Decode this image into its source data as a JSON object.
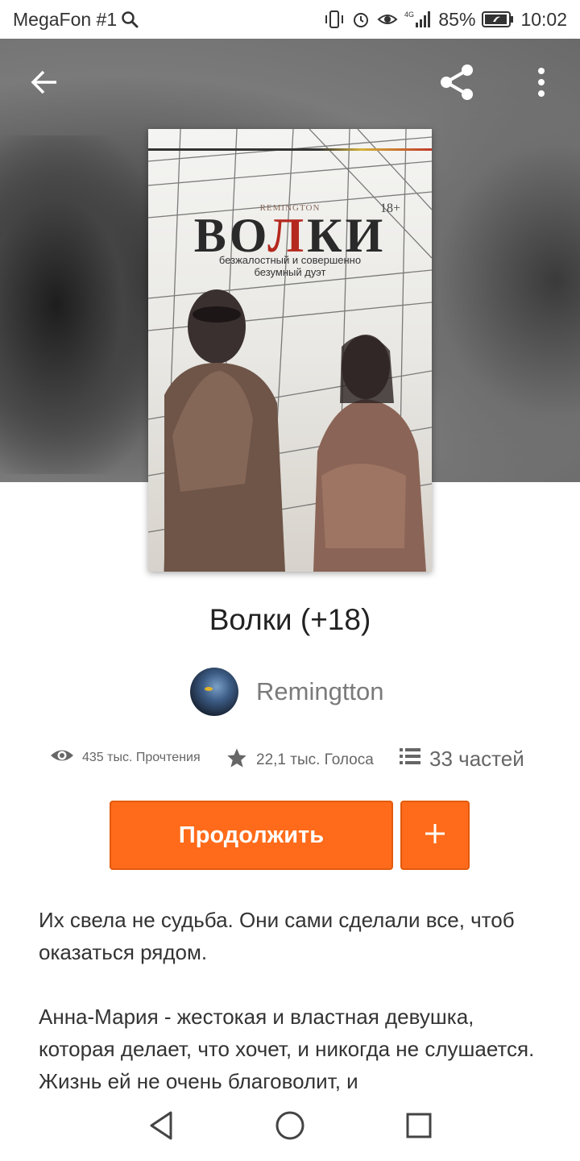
{
  "status_bar": {
    "carrier": "MegaFon #1",
    "network": "4G",
    "battery": "85%",
    "time": "10:02",
    "icons": [
      "search-icon",
      "vibrate-icon",
      "alarm-icon",
      "eye-comfort-icon",
      "signal-icon",
      "battery-icon"
    ]
  },
  "header": {
    "back_icon": "arrow-left-icon",
    "share_icon": "share-icon",
    "menu_icon": "more-vertical-icon"
  },
  "cover": {
    "brand": "REMINGTON",
    "age": "18+",
    "title_left": "ВО",
    "title_red": "Л",
    "title_right": "КИ",
    "subtitle_line1": "безжалостный и совершенно",
    "subtitle_line2": "безумный дуэт"
  },
  "book": {
    "title": "Волки (+18)",
    "author": "Remingtton"
  },
  "stats": {
    "reads": "435 тыс. Прочтения",
    "votes": "22,1 тыс. Голоса",
    "parts": "33 частей"
  },
  "actions": {
    "continue_label": "Продолжить",
    "add_icon": "plus-icon"
  },
  "description": {
    "paragraphs": [
      "Их свела не судьба. Они сами сделали все, чтоб оказаться рядом.",
      "Анна-Мария - жестокая и властная девушка, которая делает, что хочет, и никогда не слушается. Жизнь ей не очень благоволит, и"
    ]
  },
  "colors": {
    "accent": "#ff6b1a",
    "accent_border": "#e25a0c",
    "text": "#222222",
    "muted": "#7a7a7a"
  }
}
